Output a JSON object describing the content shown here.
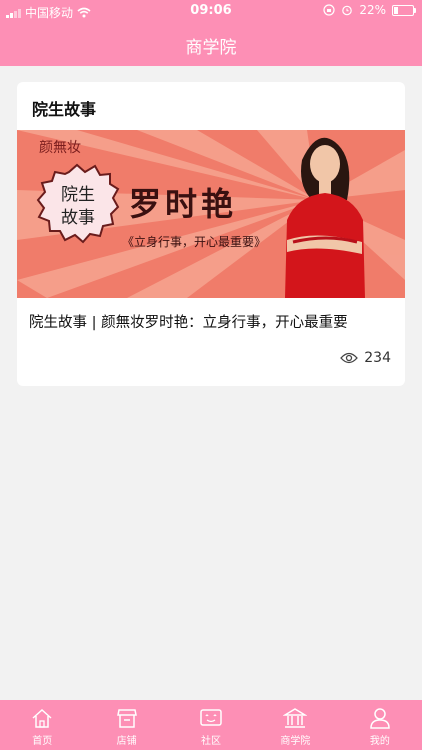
{
  "status": {
    "carrier": "中国移动",
    "time": "09:06",
    "battery": "22%",
    "battery_level": 0.22
  },
  "header": {
    "title": "商学院"
  },
  "card": {
    "section_title": "院生故事",
    "banner": {
      "logo_text": "颜無妆",
      "badge_line1": "院生",
      "badge_line2": "故事",
      "name": "罗时艳",
      "quote": "《立身行事，开心最重要》"
    },
    "article_title": "院生故事 | 颜無妆罗时艳：立身行事，开心最重要",
    "views": "234"
  },
  "tabs": [
    {
      "label": "首页",
      "icon": "home-icon"
    },
    {
      "label": "店铺",
      "icon": "shop-icon"
    },
    {
      "label": "社区",
      "icon": "community-icon"
    },
    {
      "label": "商学院",
      "icon": "academy-icon"
    },
    {
      "label": "我的",
      "icon": "profile-icon"
    }
  ],
  "colors": {
    "accent": "#fd8fb5",
    "banner_bg": "#f07c6a",
    "banner_ray": "#f4a08c"
  }
}
